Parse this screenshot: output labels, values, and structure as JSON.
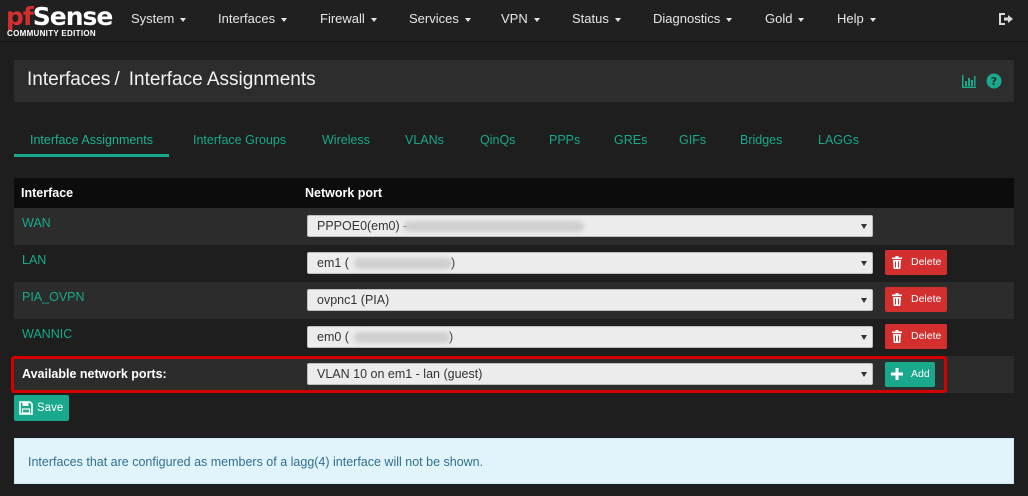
{
  "brand": {
    "logo_word": "Sense",
    "logo_mark": "pf",
    "edition": "COMMUNITY EDITION"
  },
  "nav": {
    "items": [
      "System",
      "Interfaces",
      "Firewall",
      "Services",
      "VPN",
      "Status",
      "Diagnostics",
      "Gold",
      "Help"
    ]
  },
  "breadcrumb": {
    "parent": "Interfaces",
    "separator": "/",
    "current": "Interface Assignments"
  },
  "tabs": [
    "Interface Assignments",
    "Interface Groups",
    "Wireless",
    "VLANs",
    "QinQs",
    "PPPs",
    "GREs",
    "GIFs",
    "Bridges",
    "LAGGs"
  ],
  "active_tab": "Interface Assignments",
  "table": {
    "headers": {
      "interface": "Interface",
      "network_port": "Network port"
    },
    "rows": [
      {
        "interface": "WAN",
        "port_prefix": "PPPOE0(em0) - ",
        "port_suffix": "",
        "redacted": true,
        "delete": false
      },
      {
        "interface": "LAN",
        "port_prefix": "em1 (",
        "port_suffix": ")",
        "redacted": true,
        "delete": true
      },
      {
        "interface": "PIA_OVPN",
        "port_prefix": "ovpnc1 (PIA)",
        "port_suffix": "",
        "redacted": false,
        "delete": true
      },
      {
        "interface": "WANNIC",
        "port_prefix": "em0 (",
        "port_suffix": ")",
        "redacted": true,
        "delete": true
      }
    ],
    "available": {
      "label": "Available network ports:",
      "selected": "VLAN 10 on em1 - lan (guest)"
    }
  },
  "buttons": {
    "delete": "Delete",
    "add": "Add",
    "save": "Save"
  },
  "info_message": "Interfaces that are configured as members of a lagg(4) interface will not be shown.",
  "colors": {
    "accent": "#19a88c",
    "danger": "#d32f2f",
    "highlight": "#d40000",
    "navbar": "#202020"
  },
  "icons": [
    "sign-out-icon",
    "bar-chart-icon",
    "help-icon",
    "trash-icon",
    "plus-icon",
    "save-icon",
    "caret-down-icon"
  ]
}
